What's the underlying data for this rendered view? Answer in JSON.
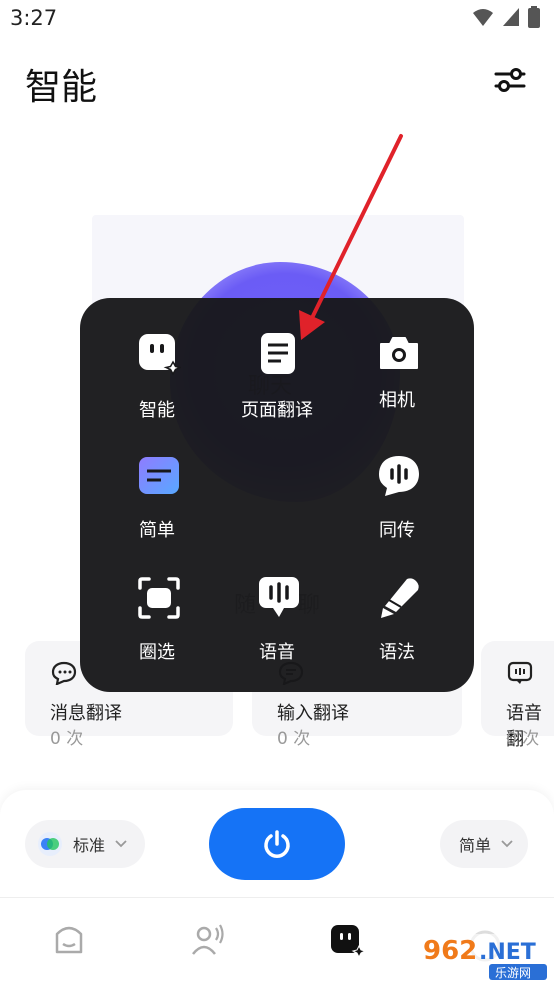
{
  "status_bar": {
    "time": "3:27"
  },
  "header": {
    "title": "智能"
  },
  "background": {
    "chat_label": "聊天",
    "companion_label": "随",
    "companion_label_end": "聊"
  },
  "stat_cards": [
    {
      "name": "消息翻译",
      "count": "0 次"
    },
    {
      "name": "输入翻译",
      "count": "0 次"
    },
    {
      "name": "语音翻",
      "count": "0 次"
    }
  ],
  "bottom_panel": {
    "mode_label": "标准",
    "style_label": "简单"
  },
  "overlay_menu": {
    "items": [
      {
        "label": "智能",
        "icon": "smart-face-icon"
      },
      {
        "label": "页面翻译",
        "icon": "page-translate-icon"
      },
      {
        "label": "相机",
        "icon": "camera-icon"
      },
      {
        "label": "简单",
        "icon": "simple-text-icon"
      },
      {
        "label": "同传",
        "icon": "simultaneous-icon"
      },
      {
        "label": "圈选",
        "icon": "circle-select-icon"
      },
      {
        "label": "语音",
        "icon": "voice-icon"
      },
      {
        "label": "语法",
        "icon": "grammar-pen-icon"
      }
    ]
  },
  "watermark": {
    "text": "962.NET",
    "sub": "乐游网"
  },
  "colors": {
    "accent": "#1573f6",
    "menu_bg": "#18181a",
    "card_bg": "#f5f5f7"
  }
}
